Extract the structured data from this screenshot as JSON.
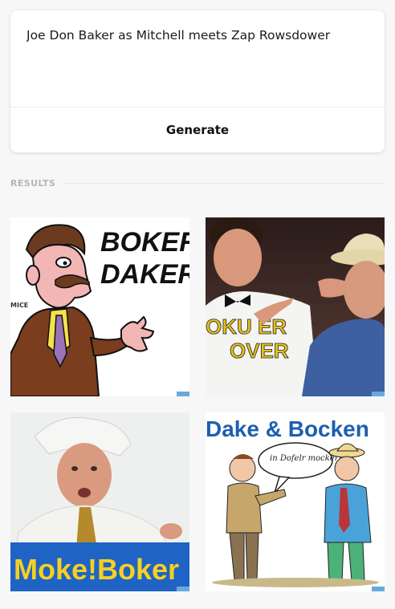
{
  "prompt": {
    "value": "Joe Don Baker as Mitchell meets Zap Rowsdower"
  },
  "actions": {
    "generate_label": "Generate"
  },
  "results": {
    "label": "RESULTS",
    "images": [
      {
        "subject": "cartoon man with mustache in brown suit",
        "lettering": [
          "BOKER",
          "DAKER"
        ],
        "side_text": "MICE"
      },
      {
        "subject": "photo of man in white shirt poking man in blue shirt and cowboy hat",
        "lettering": [
          "OKU ER",
          "OVER"
        ]
      },
      {
        "subject": "photo of man in chef hat and white jacket",
        "lettering": [
          "Moke!Boker"
        ]
      },
      {
        "subject": "cartoon of two men talking with speech bubble",
        "lettering": [
          "Dake & Bocken"
        ],
        "bubble_text": "in Dofelr mocker!"
      }
    ]
  }
}
